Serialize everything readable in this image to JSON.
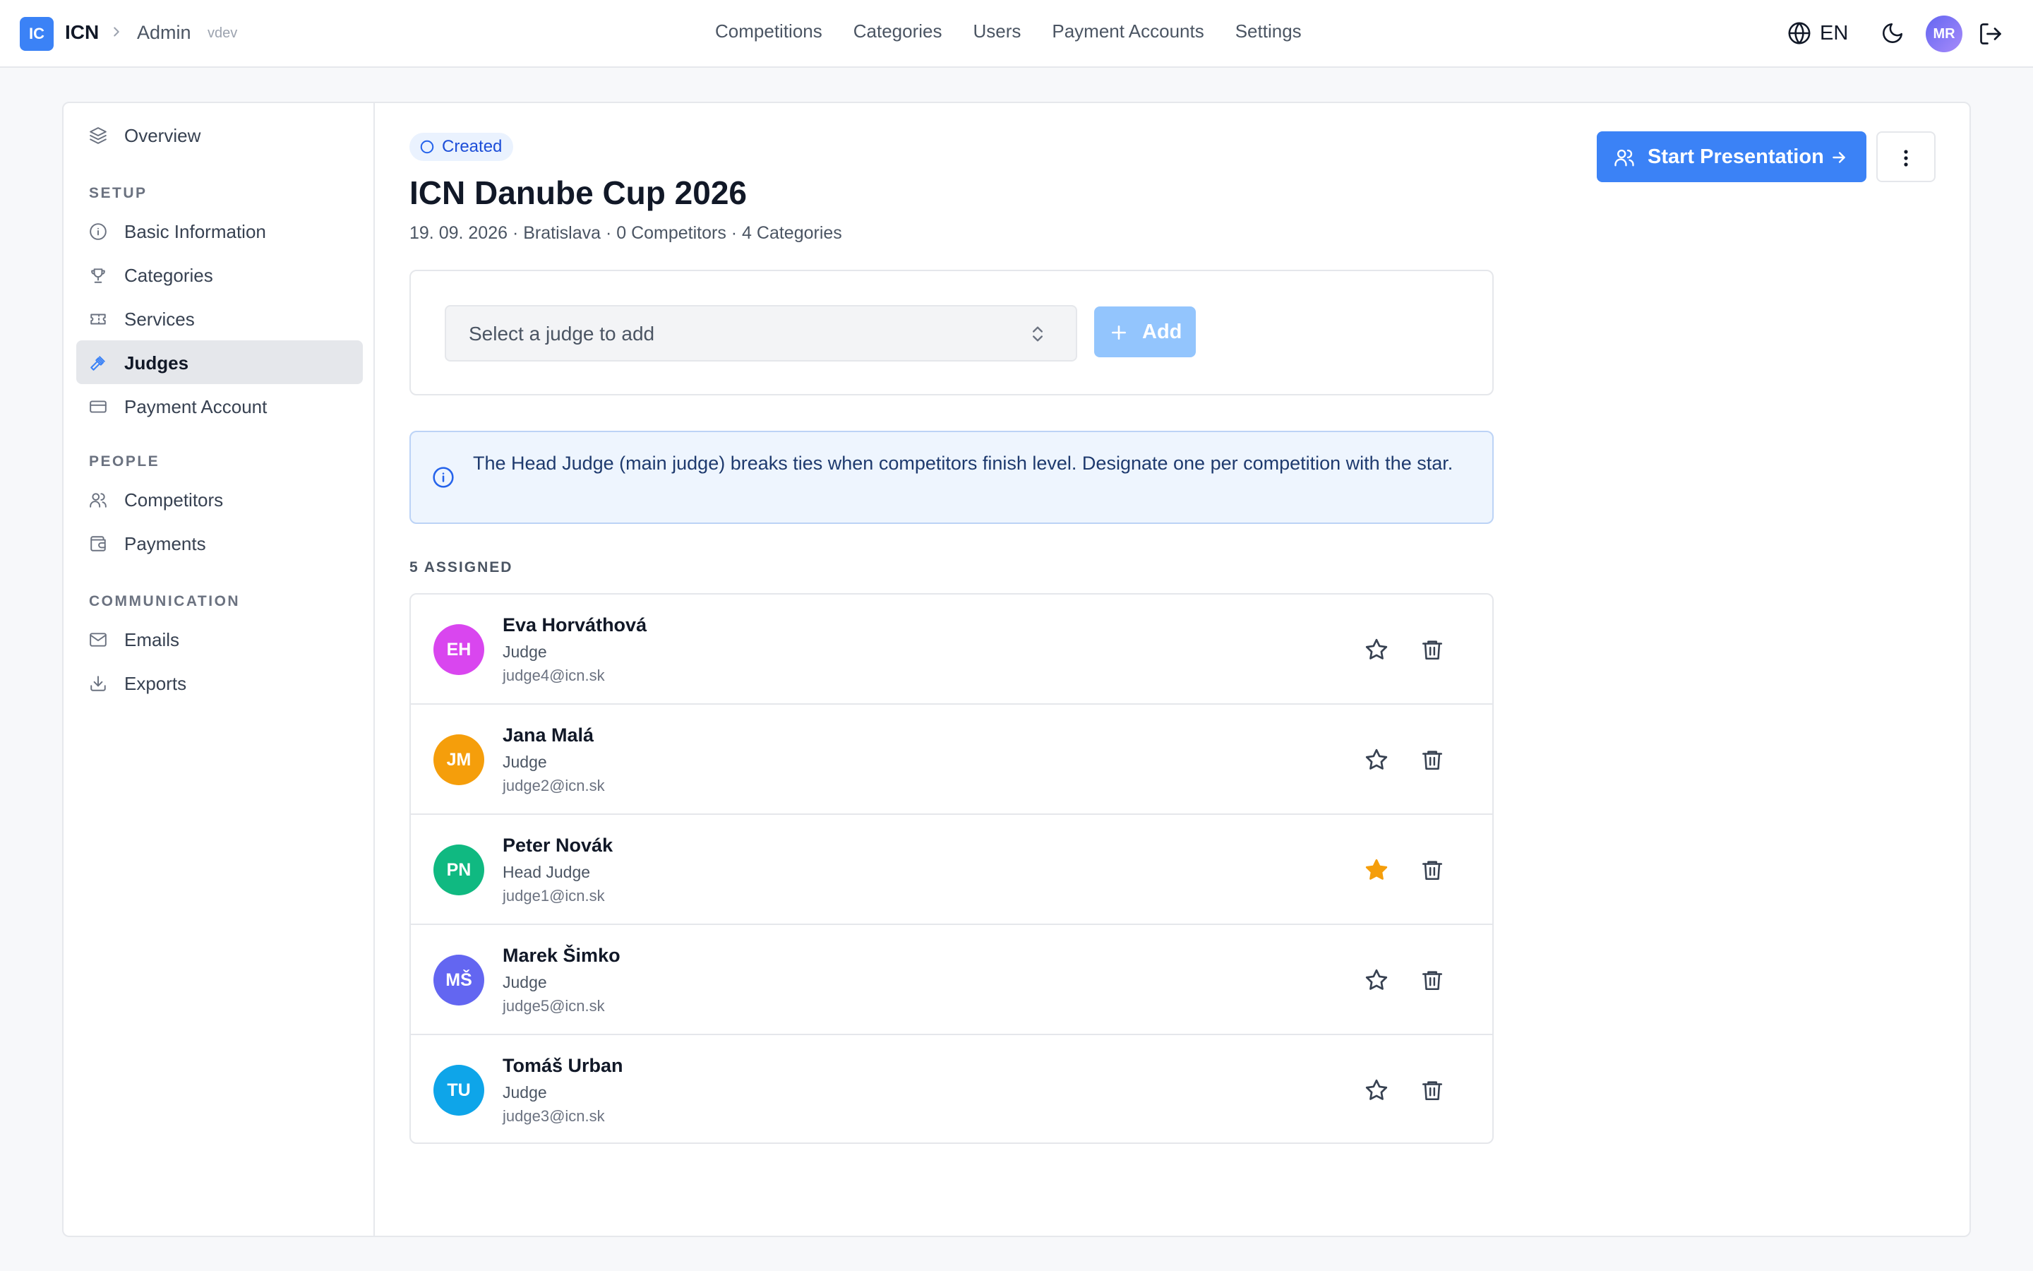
{
  "app": {
    "logo_text": "IC",
    "brand": "ICN",
    "breadcrumb_section": "Admin",
    "version": "vdev"
  },
  "topnav": {
    "items": [
      {
        "label": "Competitions"
      },
      {
        "label": "Categories"
      },
      {
        "label": "Users"
      },
      {
        "label": "Payment Accounts"
      },
      {
        "label": "Settings"
      }
    ]
  },
  "topbar_right": {
    "language": "EN",
    "user_initials": "MR",
    "icons": [
      "globe-icon",
      "moon-icon",
      "logout-icon"
    ]
  },
  "sidebar": {
    "overview": {
      "label": "Overview",
      "icon": "layers-icon"
    },
    "groups": [
      {
        "heading": "SETUP",
        "items": [
          {
            "label": "Basic Information",
            "icon": "info-icon"
          },
          {
            "label": "Categories",
            "icon": "trophy-icon"
          },
          {
            "label": "Services",
            "icon": "ticket-icon"
          },
          {
            "label": "Judges",
            "icon": "gavel-icon",
            "active": true
          },
          {
            "label": "Payment Account",
            "icon": "credit-card-icon"
          }
        ]
      },
      {
        "heading": "PEOPLE",
        "items": [
          {
            "label": "Competitors",
            "icon": "users-icon"
          },
          {
            "label": "Payments",
            "icon": "wallet-icon"
          }
        ]
      },
      {
        "heading": "COMMUNICATION",
        "items": [
          {
            "label": "Emails",
            "icon": "mail-icon"
          },
          {
            "label": "Exports",
            "icon": "download-icon"
          }
        ]
      }
    ]
  },
  "competition": {
    "status": "Created",
    "title": "ICN Danube Cup 2026",
    "meta": "19. 09. 2026 · Bratislava · 0 Competitors · 4 Categories"
  },
  "actions": {
    "start_presentation": "Start Presentation"
  },
  "add_judge": {
    "placeholder": "Select a judge to add",
    "add_label": "Add"
  },
  "info": {
    "text": "The Head Judge (main judge) breaks ties when competitors finish level. Designate one per competition with the star."
  },
  "assigned": {
    "label": "5 ASSIGNED",
    "judges": [
      {
        "initials": "EH",
        "name": "Eva Horváthová",
        "role": "Judge",
        "email": "judge4@icn.sk",
        "avatar_color": "#d946ef",
        "head": false
      },
      {
        "initials": "JM",
        "name": "Jana Malá",
        "role": "Judge",
        "email": "judge2@icn.sk",
        "avatar_color": "#f59e0b",
        "head": false
      },
      {
        "initials": "PN",
        "name": "Peter Novák",
        "role": "Head Judge",
        "email": "judge1@icn.sk",
        "avatar_color": "#10b981",
        "head": true
      },
      {
        "initials": "MŠ",
        "name": "Marek Šimko",
        "role": "Judge",
        "email": "judge5@icn.sk",
        "avatar_color": "#6366f1",
        "head": false
      },
      {
        "initials": "TU",
        "name": "Tomáš Urban",
        "role": "Judge",
        "email": "judge3@icn.sk",
        "avatar_color": "#0ea5e9",
        "head": false
      }
    ]
  },
  "colors": {
    "accent": "#3b82f6",
    "head_star": "#f59e0b",
    "info_bg": "#eef5fe"
  }
}
